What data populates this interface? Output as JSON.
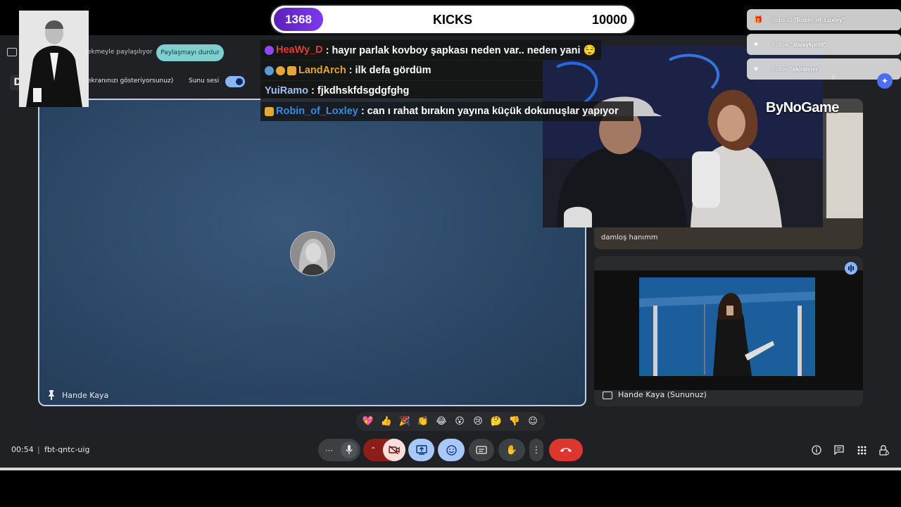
{
  "stream": {
    "kicks_count": "1368",
    "kicks_label": "KICKS",
    "kicks_goal": "10000",
    "logo": "ByNoGame"
  },
  "chat": [
    {
      "user": "HeaWy_D",
      "message": ": hayır parlak kovboy şapkası neden var.. neden yani 😌",
      "user_color": "#e23b3b",
      "badges": [
        "purple"
      ]
    },
    {
      "user": "LandArch",
      "message": ": ilk defa gördüm",
      "user_color": "#e2a73b",
      "badges": [
        "blue",
        "gold",
        "gold"
      ]
    },
    {
      "user": "YuiRamo",
      "message": ": fjkdhskfdsgdgfghg",
      "user_color": "#9fc2f0",
      "badges": []
    },
    {
      "user": "Robin_of_Loxley",
      "message": ": can ı rahat bırakın yayına küçük dokunuşlar yapıyor",
      "user_color": "#3b8ae2",
      "badges": [
        "gold"
      ]
    }
  ],
  "alerts": [
    {
      "icon": "gift-icon",
      "prefix": "Subs x1",
      "name": "\"Robin_of_Loxley\""
    },
    {
      "icon": "heart-icon",
      "prefix": "Follow",
      "name": "\"atalaykpr08\""
    },
    {
      "icon": "heart-icon",
      "prefix": "Follow",
      "name": "\"ekinbenn\""
    }
  ],
  "share_bar": {
    "sharing_text": "ekmeyle paylaşılıyor",
    "stop_label": "Paylaşmayı durdur",
    "presenting_text": "ekranınızı gösteriyorsunuz)",
    "audio_label": "Sunu sesi",
    "pres_letter": "D"
  },
  "tiles": {
    "main_name": "Hande Kaya",
    "damlos_name": "damloş hanımm",
    "present_name": "Hande Kaya (Sununuz)"
  },
  "reactions": [
    "💖",
    "👍",
    "🎉",
    "👏",
    "😂",
    "😮",
    "😢",
    "🤔",
    "👎",
    "☺"
  ],
  "footer": {
    "time": "00:54",
    "separator": "|",
    "meeting_code": "fbt-qntc-uig"
  },
  "participant_count": "3",
  "colors": {
    "end_call": "#d93025",
    "accent_blue": "#8ab4f8",
    "stop_share": "#7fcfd1",
    "cam_off": "#f9dedc",
    "kicks_purple": "#6d28d9"
  }
}
